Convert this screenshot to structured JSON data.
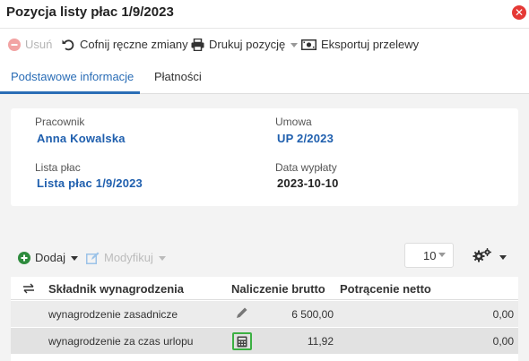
{
  "window": {
    "title": "Pozycja listy płac 1/9/2023",
    "close_icon": "close-icon"
  },
  "toolbar": {
    "delete_label": "Usuń",
    "undo_label": "Cofnij ręczne zmiany",
    "print_label": "Drukuj pozycję",
    "export_label": "Eksportuj przelewy"
  },
  "tabs": [
    {
      "label": "Podstawowe informacje",
      "active": true
    },
    {
      "label": "Płatności",
      "active": false
    }
  ],
  "info": {
    "employee_label": "Pracownik",
    "employee_value": "Anna Kowalska",
    "contract_label": "Umowa",
    "contract_value": "UP 2/2023",
    "payroll_label": "Lista płac",
    "payroll_value": "Lista płac 1/9/2023",
    "paydate_label": "Data wypłaty",
    "paydate_value": "2023-10-10"
  },
  "list_toolbar": {
    "add_label": "Dodaj",
    "modify_label": "Modyfikuj",
    "page_size": "10"
  },
  "table": {
    "headers": {
      "component": "Składnik wynagrodzenia",
      "gross": "Naliczenie brutto",
      "net": "Potrącenie netto"
    },
    "rows": [
      {
        "component": "wynagrodzenie zasadnicze",
        "gross": "6 500,00",
        "net": "0,00",
        "icon": "pencil-icon"
      },
      {
        "component": "wynagrodzenie za czas urlopu",
        "gross": "11,92",
        "net": "0,00",
        "icon": "calculator-icon"
      }
    ]
  },
  "colors": {
    "accent": "#2a6db6",
    "danger": "#e53935",
    "success": "#3cb043"
  }
}
